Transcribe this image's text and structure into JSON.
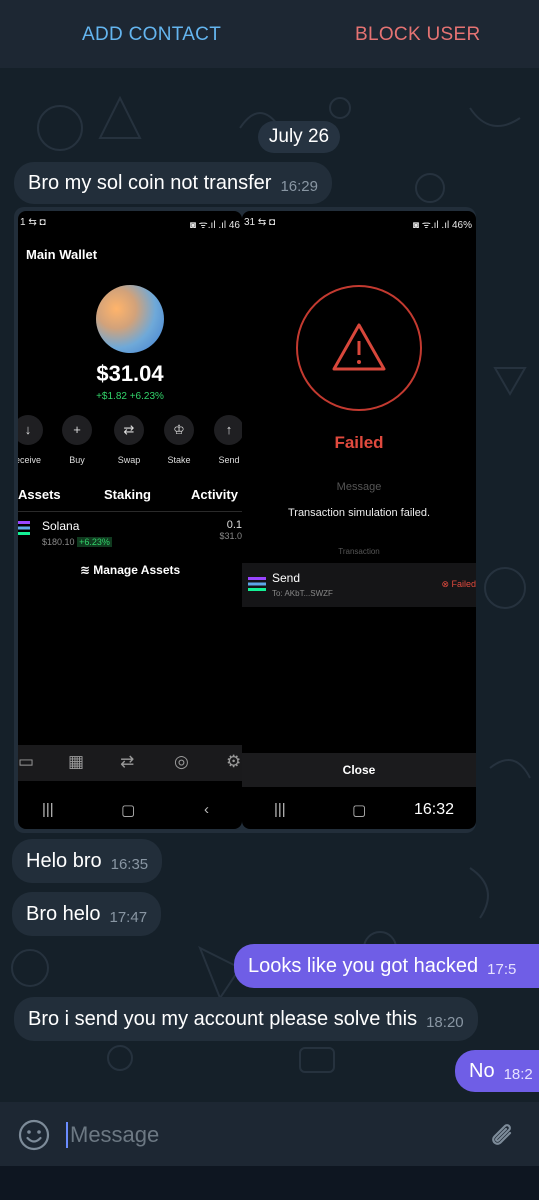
{
  "topbar": {
    "add_contact": "ADD CONTACT",
    "block_user": "BLOCK USER",
    "accent": "#64b5ef",
    "danger": "#e57373"
  },
  "date_divider": "July 26",
  "messages": [
    {
      "dir": "in",
      "text": "Bro my sol coin not transfer",
      "time": "16:29"
    },
    {
      "dir": "in",
      "text": "Helo bro",
      "time": "16:35"
    },
    {
      "dir": "in",
      "text": "Bro helo",
      "time": "17:47"
    },
    {
      "dir": "out",
      "text": "Looks like you got hacked",
      "time": "17:5"
    },
    {
      "dir": "in",
      "text": "Bro i send you my account please solve this",
      "time": "18:20"
    },
    {
      "dir": "out",
      "text": "No",
      "time": "18:2"
    }
  ],
  "media": {
    "time": "16:32",
    "left": {
      "status": "1 ⇆ ◘",
      "status_right": "◙ ᯤ.ıl .ıl 46",
      "title": "Main Wallet",
      "balance": "$31.04",
      "change": "+$1.82  +6.23%",
      "actions": [
        {
          "icon": "↓",
          "label": "eceive"
        },
        {
          "icon": "+",
          "label": "Buy"
        },
        {
          "icon": "⇄",
          "label": "Swap"
        },
        {
          "icon": "♔",
          "label": "Stake"
        },
        {
          "icon": "↑",
          "label": "Send"
        }
      ],
      "tabs": [
        "Assets",
        "Staking",
        "Activity"
      ],
      "asset": {
        "name": "Solana",
        "price": "$180.10",
        "pct": "+6.23%",
        "amount": "0.1",
        "value": "$31.0"
      },
      "manage": "≋ Manage Assets"
    },
    "right": {
      "status": "31 ⇆ ◘",
      "status_right": "◙ ᯤ.ıl .ıl 46%",
      "failed": "Failed",
      "message_label": "Message",
      "message": "Transaction simulation failed.",
      "tx_label": "Transaction",
      "tx_name": "Send",
      "tx_to": "To: AKbT...SWZF",
      "tx_status": "⊗ Failed",
      "close": "Close"
    }
  },
  "composer": {
    "placeholder": "Message"
  }
}
